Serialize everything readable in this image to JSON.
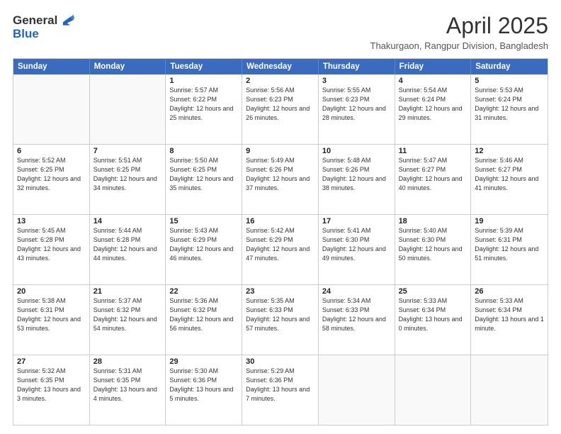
{
  "header": {
    "logo_line1": "General",
    "logo_line2": "Blue",
    "month_year": "April 2025",
    "location": "Thakurgaon, Rangpur Division, Bangladesh"
  },
  "days_of_week": [
    "Sunday",
    "Monday",
    "Tuesday",
    "Wednesday",
    "Thursday",
    "Friday",
    "Saturday"
  ],
  "weeks": [
    [
      {
        "day": "",
        "empty": true
      },
      {
        "day": "",
        "empty": true
      },
      {
        "day": "1",
        "sunrise": "5:57 AM",
        "sunset": "6:22 PM",
        "daylight": "12 hours and 25 minutes."
      },
      {
        "day": "2",
        "sunrise": "5:56 AM",
        "sunset": "6:23 PM",
        "daylight": "12 hours and 26 minutes."
      },
      {
        "day": "3",
        "sunrise": "5:55 AM",
        "sunset": "6:23 PM",
        "daylight": "12 hours and 28 minutes."
      },
      {
        "day": "4",
        "sunrise": "5:54 AM",
        "sunset": "6:24 PM",
        "daylight": "12 hours and 29 minutes."
      },
      {
        "day": "5",
        "sunrise": "5:53 AM",
        "sunset": "6:24 PM",
        "daylight": "12 hours and 31 minutes."
      }
    ],
    [
      {
        "day": "6",
        "sunrise": "5:52 AM",
        "sunset": "6:25 PM",
        "daylight": "12 hours and 32 minutes."
      },
      {
        "day": "7",
        "sunrise": "5:51 AM",
        "sunset": "6:25 PM",
        "daylight": "12 hours and 34 minutes."
      },
      {
        "day": "8",
        "sunrise": "5:50 AM",
        "sunset": "6:25 PM",
        "daylight": "12 hours and 35 minutes."
      },
      {
        "day": "9",
        "sunrise": "5:49 AM",
        "sunset": "6:26 PM",
        "daylight": "12 hours and 37 minutes."
      },
      {
        "day": "10",
        "sunrise": "5:48 AM",
        "sunset": "6:26 PM",
        "daylight": "12 hours and 38 minutes."
      },
      {
        "day": "11",
        "sunrise": "5:47 AM",
        "sunset": "6:27 PM",
        "daylight": "12 hours and 40 minutes."
      },
      {
        "day": "12",
        "sunrise": "5:46 AM",
        "sunset": "6:27 PM",
        "daylight": "12 hours and 41 minutes."
      }
    ],
    [
      {
        "day": "13",
        "sunrise": "5:45 AM",
        "sunset": "6:28 PM",
        "daylight": "12 hours and 43 minutes."
      },
      {
        "day": "14",
        "sunrise": "5:44 AM",
        "sunset": "6:28 PM",
        "daylight": "12 hours and 44 minutes."
      },
      {
        "day": "15",
        "sunrise": "5:43 AM",
        "sunset": "6:29 PM",
        "daylight": "12 hours and 46 minutes."
      },
      {
        "day": "16",
        "sunrise": "5:42 AM",
        "sunset": "6:29 PM",
        "daylight": "12 hours and 47 minutes."
      },
      {
        "day": "17",
        "sunrise": "5:41 AM",
        "sunset": "6:30 PM",
        "daylight": "12 hours and 49 minutes."
      },
      {
        "day": "18",
        "sunrise": "5:40 AM",
        "sunset": "6:30 PM",
        "daylight": "12 hours and 50 minutes."
      },
      {
        "day": "19",
        "sunrise": "5:39 AM",
        "sunset": "6:31 PM",
        "daylight": "12 hours and 51 minutes."
      }
    ],
    [
      {
        "day": "20",
        "sunrise": "5:38 AM",
        "sunset": "6:31 PM",
        "daylight": "12 hours and 53 minutes."
      },
      {
        "day": "21",
        "sunrise": "5:37 AM",
        "sunset": "6:32 PM",
        "daylight": "12 hours and 54 minutes."
      },
      {
        "day": "22",
        "sunrise": "5:36 AM",
        "sunset": "6:32 PM",
        "daylight": "12 hours and 56 minutes."
      },
      {
        "day": "23",
        "sunrise": "5:35 AM",
        "sunset": "6:33 PM",
        "daylight": "12 hours and 57 minutes."
      },
      {
        "day": "24",
        "sunrise": "5:34 AM",
        "sunset": "6:33 PM",
        "daylight": "12 hours and 58 minutes."
      },
      {
        "day": "25",
        "sunrise": "5:33 AM",
        "sunset": "6:34 PM",
        "daylight": "13 hours and 0 minutes."
      },
      {
        "day": "26",
        "sunrise": "5:33 AM",
        "sunset": "6:34 PM",
        "daylight": "13 hours and 1 minute."
      }
    ],
    [
      {
        "day": "27",
        "sunrise": "5:32 AM",
        "sunset": "6:35 PM",
        "daylight": "13 hours and 3 minutes."
      },
      {
        "day": "28",
        "sunrise": "5:31 AM",
        "sunset": "6:35 PM",
        "daylight": "13 hours and 4 minutes."
      },
      {
        "day": "29",
        "sunrise": "5:30 AM",
        "sunset": "6:36 PM",
        "daylight": "13 hours and 5 minutes."
      },
      {
        "day": "30",
        "sunrise": "5:29 AM",
        "sunset": "6:36 PM",
        "daylight": "13 hours and 7 minutes."
      },
      {
        "day": "",
        "empty": true
      },
      {
        "day": "",
        "empty": true
      },
      {
        "day": "",
        "empty": true
      }
    ]
  ]
}
